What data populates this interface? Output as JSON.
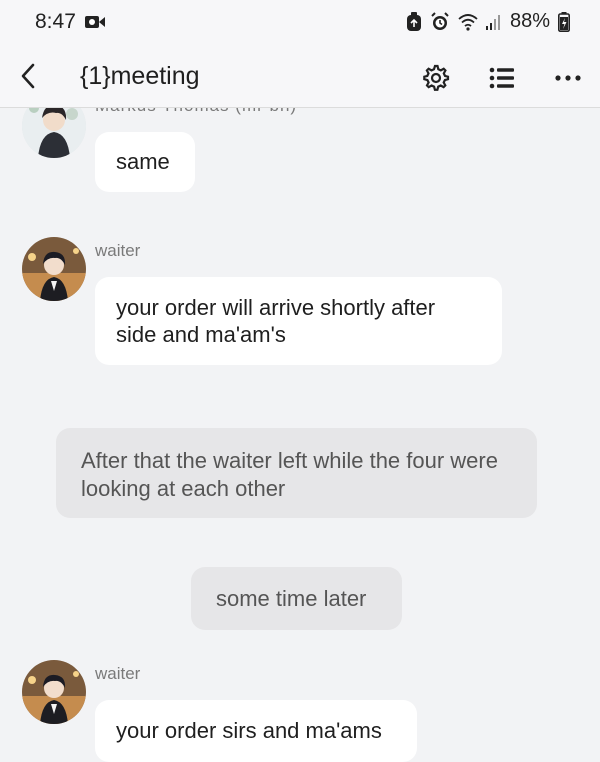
{
  "status_bar": {
    "time": "8:47",
    "battery": "88%"
  },
  "header": {
    "title": "{1}meeting"
  },
  "messages": {
    "m0": {
      "sender_partial": "Markus Thomas (mr bh)",
      "text": "same"
    },
    "m1": {
      "sender": "waiter",
      "text": "your order will arrive shortly after side and ma'am's"
    },
    "narration1": {
      "text": "After that the waiter left while the four were looking at each other"
    },
    "narration2": {
      "text": "some time later"
    },
    "m2": {
      "sender": "waiter",
      "text": "your order sirs and ma'ams"
    }
  },
  "colors": {
    "background": "#f2f3f5",
    "bubble": "#ffffff",
    "narration_bubble": "#e6e6e8",
    "sender_text": "#7a7a7a"
  },
  "icons": [
    "video-record-icon",
    "recycle-icon",
    "alarm-icon",
    "wifi-icon",
    "signal-icon",
    "battery-charging-icon",
    "back-arrow-icon",
    "settings-gear-icon",
    "list-icon",
    "more-options-icon"
  ]
}
